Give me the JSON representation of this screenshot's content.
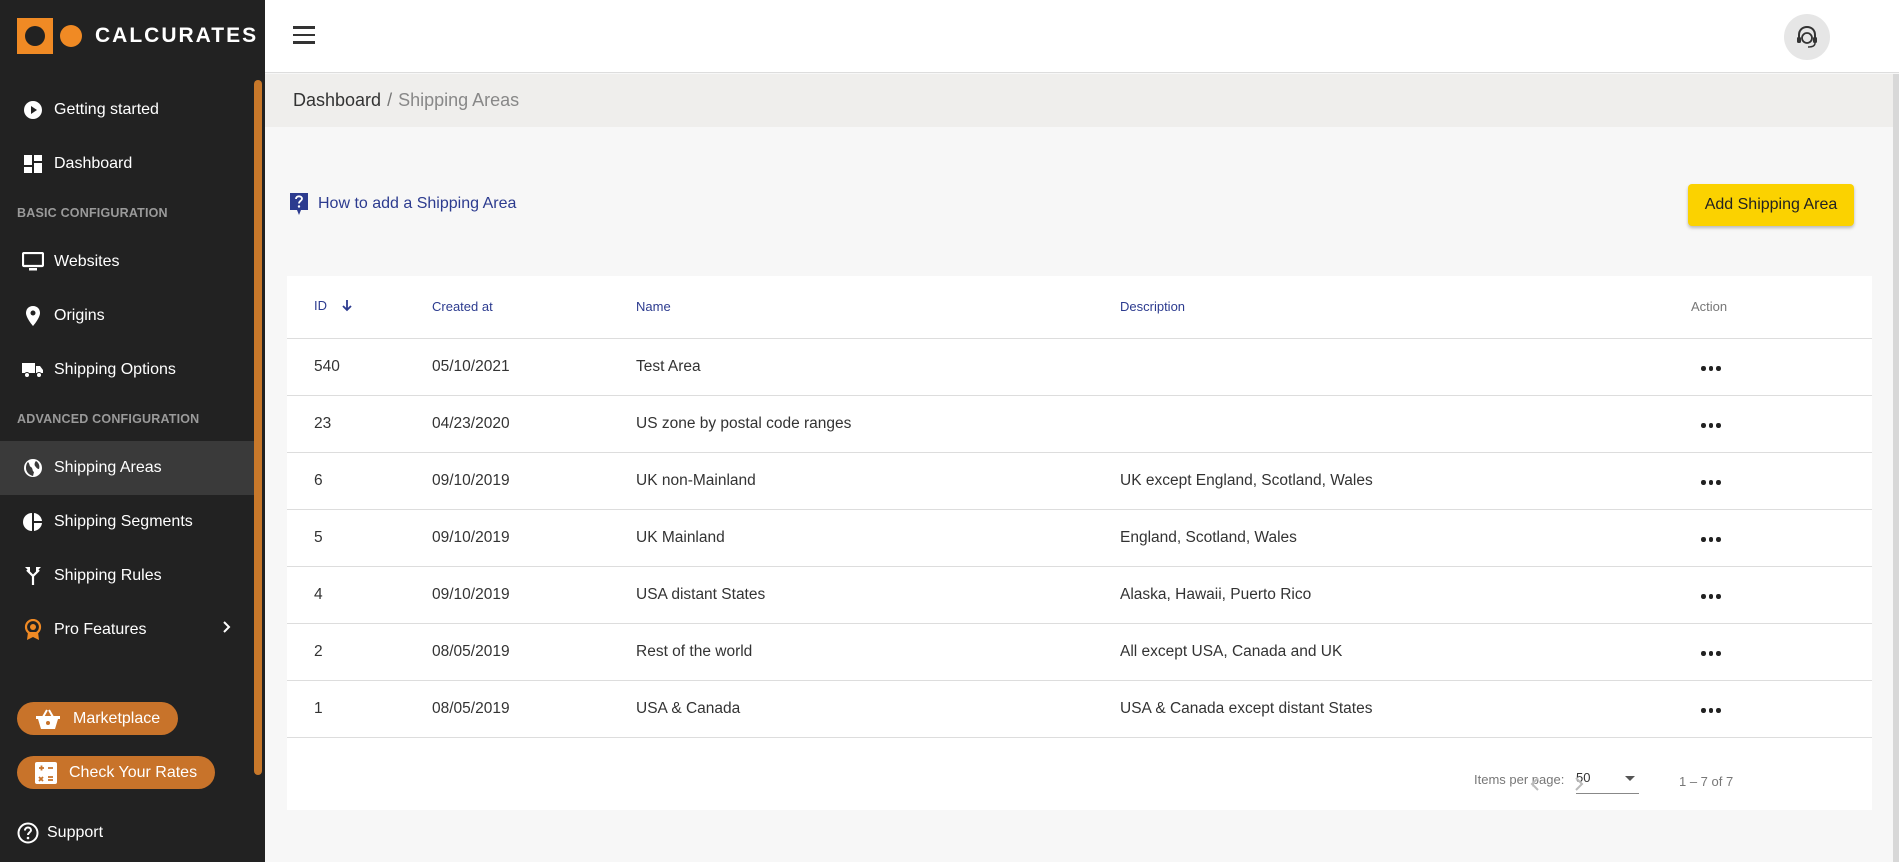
{
  "app": {
    "name": "CALCURATES"
  },
  "sidebar": {
    "items_top": [
      {
        "label": "Getting started",
        "icon": "play-circle-icon"
      },
      {
        "label": "Dashboard",
        "icon": "dashboard-icon"
      }
    ],
    "section_basic": "BASIC CONFIGURATION",
    "items_basic": [
      {
        "label": "Websites",
        "icon": "monitor-icon"
      },
      {
        "label": "Origins",
        "icon": "map-pin-icon"
      },
      {
        "label": "Shipping Options",
        "icon": "truck-icon"
      }
    ],
    "section_advanced": "ADVANCED CONFIGURATION",
    "items_advanced": [
      {
        "label": "Shipping Areas",
        "icon": "globe-icon",
        "active": true
      },
      {
        "label": "Shipping Segments",
        "icon": "pie-chart-icon"
      },
      {
        "label": "Shipping Rules",
        "icon": "fork-icon"
      },
      {
        "label": "Pro Features",
        "icon": "badge-icon"
      }
    ],
    "marketplace": "Marketplace",
    "check_rates": "Check Your Rates",
    "support": "Support",
    "accent_color": "#c8732a"
  },
  "breadcrumb": {
    "root": "Dashboard",
    "separator": "/",
    "current": "Shipping Areas"
  },
  "content": {
    "help_link": "How to add a Shipping Area",
    "add_button": "Add Shipping Area",
    "add_button_color": "#fbd200"
  },
  "table": {
    "headers": {
      "id": "ID",
      "created": "Created at",
      "name": "Name",
      "description": "Description",
      "action": "Action"
    },
    "rows": [
      {
        "id": "540",
        "created": "05/10/2021",
        "name": "Test Area",
        "description": ""
      },
      {
        "id": "23",
        "created": "04/23/2020",
        "name": "US zone by postal code ranges",
        "description": ""
      },
      {
        "id": "6",
        "created": "09/10/2019",
        "name": "UK non-Mainland",
        "description": "UK except England, Scotland, Wales"
      },
      {
        "id": "5",
        "created": "09/10/2019",
        "name": "UK Mainland",
        "description": "England, Scotland, Wales"
      },
      {
        "id": "4",
        "created": "09/10/2019",
        "name": "USA distant States",
        "description": "Alaska, Hawaii, Puerto Rico"
      },
      {
        "id": "2",
        "created": "08/05/2019",
        "name": "Rest of the world",
        "description": "All except USA, Canada and UK"
      },
      {
        "id": "1",
        "created": "08/05/2019",
        "name": "USA & Canada",
        "description": "USA & Canada except distant States"
      }
    ]
  },
  "paginator": {
    "items_per_page_label": "Items per page:",
    "items_per_page": "50",
    "range": "1 – 7 of 7"
  }
}
